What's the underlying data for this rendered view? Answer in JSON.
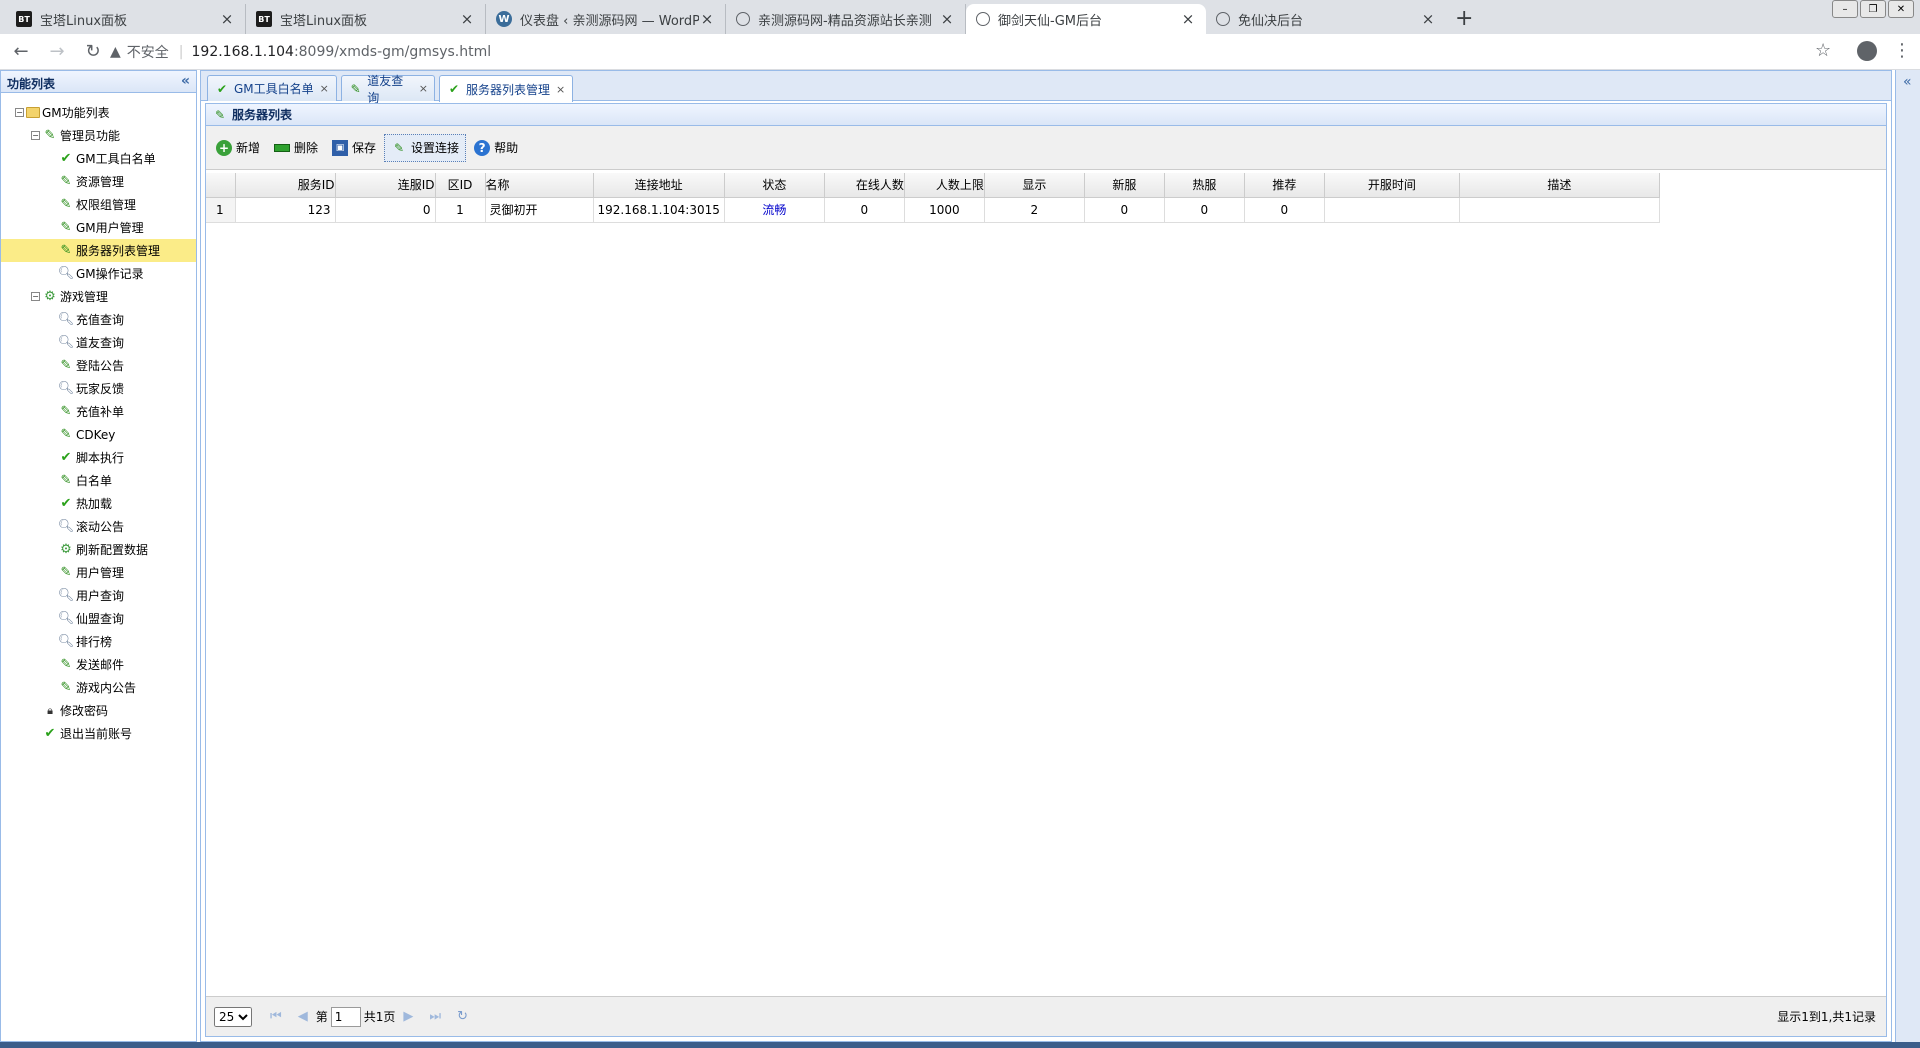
{
  "browser": {
    "tabs": [
      {
        "title": "宝塔Linux面板",
        "favicon": "bt"
      },
      {
        "title": "宝塔Linux面板",
        "favicon": "bt"
      },
      {
        "title": "仪表盘 ‹ 亲测源码网 — WordPr",
        "favicon": "wp"
      },
      {
        "title": "亲测源码网-精品资源站长亲测",
        "favicon": "globe"
      },
      {
        "title": "御剑天仙-GM后台",
        "favicon": "globe"
      },
      {
        "title": "免仙决后台",
        "favicon": "globe"
      }
    ],
    "address": {
      "insecure_label": "不安全",
      "host": "192.168.1.104",
      "path": ":8099/xmds-gm/gmsys.html"
    }
  },
  "sidebar": {
    "title": "功能列表",
    "tree": [
      {
        "label": "GM功能列表",
        "level": 0,
        "icon": "folder-icon",
        "expander": "⊟"
      },
      {
        "label": "管理员功能",
        "level": 1,
        "icon": "pencil-icon",
        "expander": "⊟"
      },
      {
        "label": "GM工具白名单",
        "level": 2,
        "icon": "check-icon"
      },
      {
        "label": "资源管理",
        "level": 2,
        "icon": "pencil-icon"
      },
      {
        "label": "权限组管理",
        "level": 2,
        "icon": "pencil-icon"
      },
      {
        "label": "GM用户管理",
        "level": 2,
        "icon": "pencil-icon"
      },
      {
        "label": "服务器列表管理",
        "level": 2,
        "icon": "pencil-icon",
        "selected": true
      },
      {
        "label": "GM操作记录",
        "level": 2,
        "icon": "magnifier-icon"
      },
      {
        "label": "游戏管理",
        "level": 1,
        "icon": "gear-icon",
        "expander": "⊟"
      },
      {
        "label": "充值查询",
        "level": 2,
        "icon": "magnifier-icon"
      },
      {
        "label": "道友查询",
        "level": 2,
        "icon": "magnifier-icon"
      },
      {
        "label": "登陆公告",
        "level": 2,
        "icon": "pencil-icon"
      },
      {
        "label": "玩家反馈",
        "level": 2,
        "icon": "magnifier-icon"
      },
      {
        "label": "充值补单",
        "level": 2,
        "icon": "pencil-icon"
      },
      {
        "label": "CDKey",
        "level": 2,
        "icon": "pencil-icon"
      },
      {
        "label": "脚本执行",
        "level": 2,
        "icon": "check-icon"
      },
      {
        "label": "白名单",
        "level": 2,
        "icon": "pencil-icon"
      },
      {
        "label": "热加载",
        "level": 2,
        "icon": "check-icon"
      },
      {
        "label": "滚动公告",
        "level": 2,
        "icon": "magnifier-icon"
      },
      {
        "label": "刷新配置数据",
        "level": 2,
        "icon": "gear-icon"
      },
      {
        "label": "用户管理",
        "level": 2,
        "icon": "pencil-icon"
      },
      {
        "label": "用户查询",
        "level": 2,
        "icon": "magnifier-icon"
      },
      {
        "label": "仙盟查询",
        "level": 2,
        "icon": "magnifier-icon"
      },
      {
        "label": "排行榜",
        "level": 2,
        "icon": "magnifier-icon"
      },
      {
        "label": "发送邮件",
        "level": 2,
        "icon": "pencil-icon"
      },
      {
        "label": "游戏内公告",
        "level": 2,
        "icon": "pencil-icon"
      },
      {
        "label": "修改密码",
        "level": 1,
        "icon": "lock-icon"
      },
      {
        "label": "退出当前账号",
        "level": 1,
        "icon": "check-icon"
      }
    ]
  },
  "content_tabs": [
    {
      "label": "GM工具白名单",
      "icon": "check-icon"
    },
    {
      "label": "道友查询",
      "icon": "pencil-icon"
    },
    {
      "label": "服务器列表管理",
      "icon": "check-icon",
      "active": true
    }
  ],
  "panel": {
    "title": "服务器列表",
    "toolbar": {
      "add": "新增",
      "delete": "删除",
      "save": "保存",
      "set_connection": "设置连接",
      "help": "帮助"
    }
  },
  "grid": {
    "columns": [
      "服务ID",
      "连服ID",
      "区ID",
      "名称",
      "连接地址",
      "状态",
      "在线人数",
      "人数上限",
      "显示",
      "新服",
      "热服",
      "推荐",
      "开服时间",
      "描述"
    ],
    "rows": [
      {
        "rownum": "1",
        "cells": [
          "123",
          "0",
          "1",
          "灵御初开",
          "192.168.1.104:3015",
          "流畅",
          "0",
          "1000",
          "2",
          "0",
          "0",
          "0",
          "",
          ""
        ]
      }
    ]
  },
  "pager": {
    "page_size": "25",
    "page_prefix": "第",
    "page_value": "1",
    "page_total": "共1页",
    "info": "显示1到1,共1记录"
  },
  "colors": {
    "border": "#99bbe8",
    "header_bg": "#dbe6f7",
    "selected_row": "#fbec88",
    "status_ok": "#0000cc"
  }
}
